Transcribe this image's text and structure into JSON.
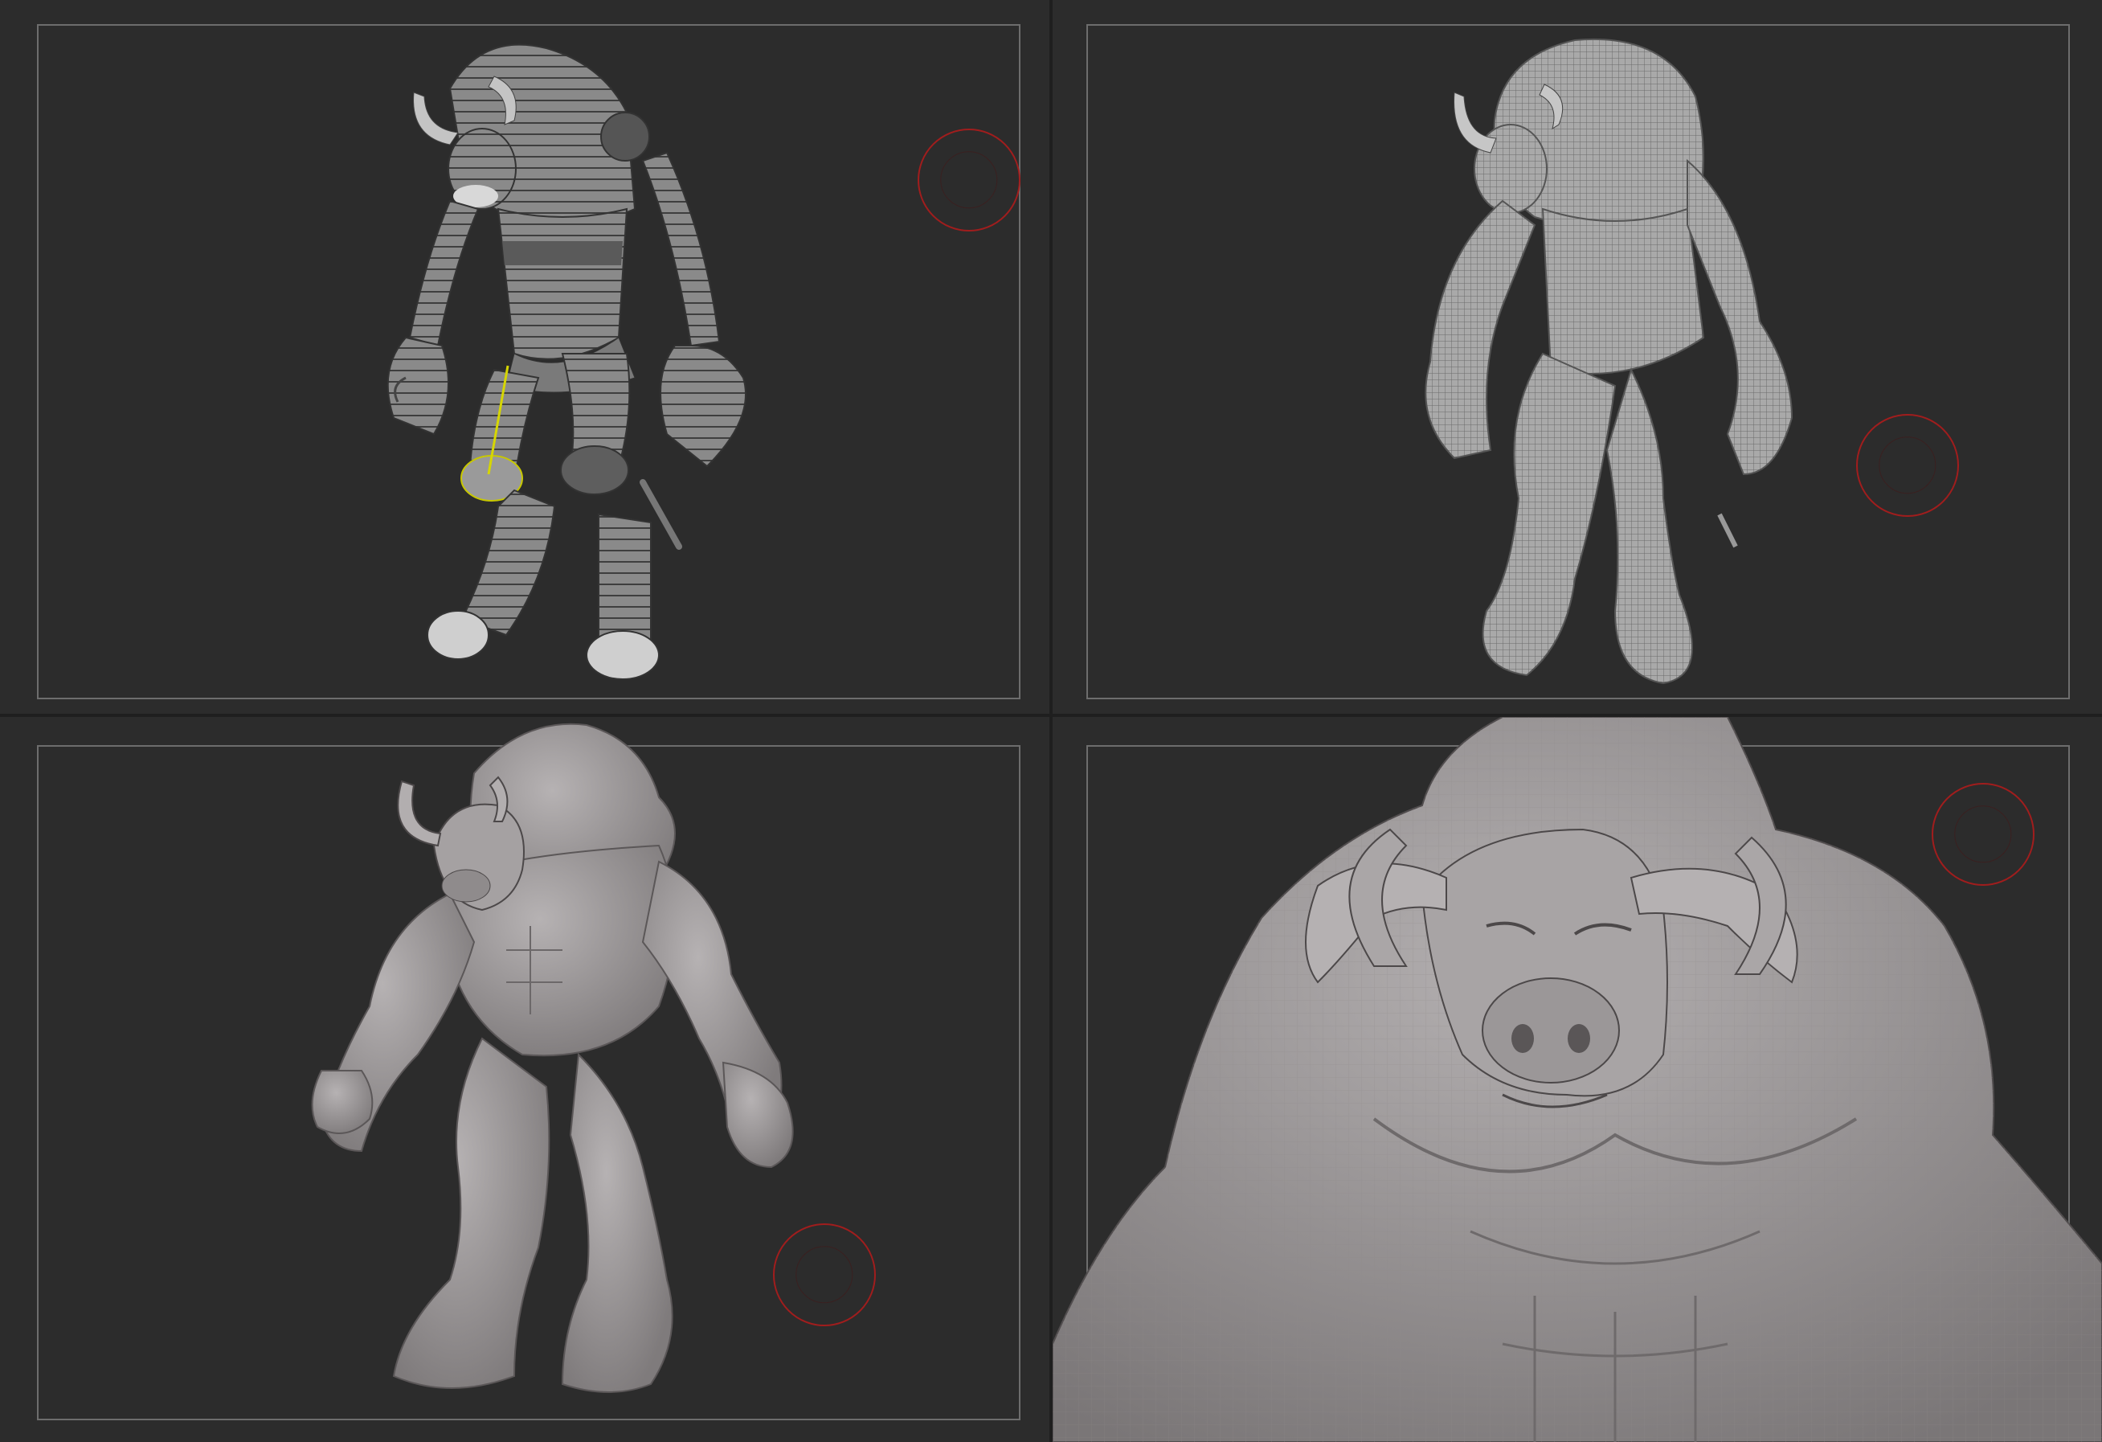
{
  "app": {
    "title": ""
  },
  "viewports": [
    {
      "id": "vp-1",
      "stage": "blockout"
    },
    {
      "id": "vp-2",
      "stage": "dynamesh"
    },
    {
      "id": "vp-3",
      "stage": "sculpt"
    },
    {
      "id": "vp-4",
      "stage": "closeup"
    }
  ],
  "colors": {
    "background": "#2c2c2c",
    "frame": "#6d6d6d",
    "brush_cursor": "#a11d1d",
    "mesh": "#8e8e8e",
    "clay": "#a7a3a4"
  },
  "icons": [
    "brush-cursor-icon"
  ]
}
